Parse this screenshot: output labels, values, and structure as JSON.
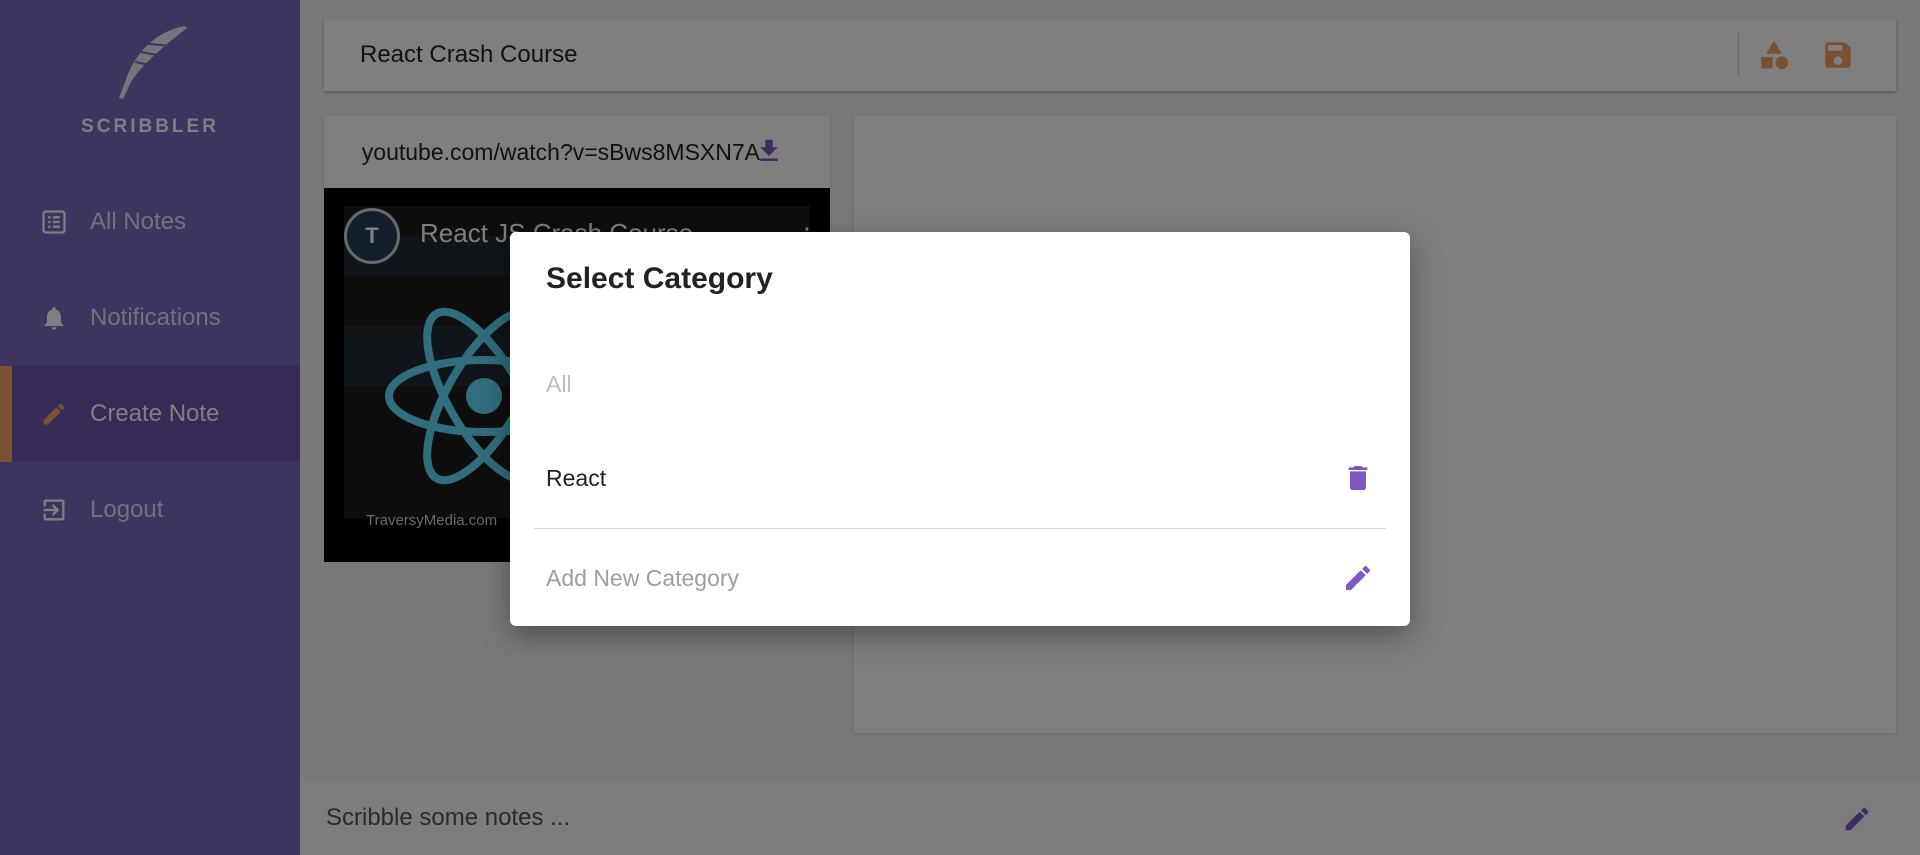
{
  "app": {
    "brand": "SCRIBBLER",
    "colors": {
      "sidebar": "#7b68c0",
      "accent": "#f4a261",
      "icon_purple": "#7e57c2"
    }
  },
  "sidebar": {
    "items": [
      {
        "label": "All Notes",
        "icon": "list-icon",
        "active": false
      },
      {
        "label": "Notifications",
        "icon": "bell-icon",
        "active": false
      },
      {
        "label": "Create Note",
        "icon": "pencil-icon",
        "active": true
      },
      {
        "label": "Logout",
        "icon": "logout-icon",
        "active": false
      }
    ]
  },
  "note": {
    "title": "React Crash Course",
    "actions": [
      {
        "icon": "shapes-icon"
      },
      {
        "icon": "save-icon"
      }
    ]
  },
  "video": {
    "url": "https://www.youtube.com/watch?v=sBws8MSXN7A",
    "title": "React JS Crash Course",
    "channel_initial": "T",
    "watermark": "TraversyMedia.com"
  },
  "editor": {
    "placeholder": "Scribble some notes ..."
  },
  "dialog": {
    "title": "Select Category",
    "options": [
      {
        "label": "All",
        "disabled": true
      },
      {
        "label": "React",
        "action_icon": "trash-icon"
      }
    ],
    "add_label": "Add New Category",
    "add_icon": "pencil-icon"
  }
}
